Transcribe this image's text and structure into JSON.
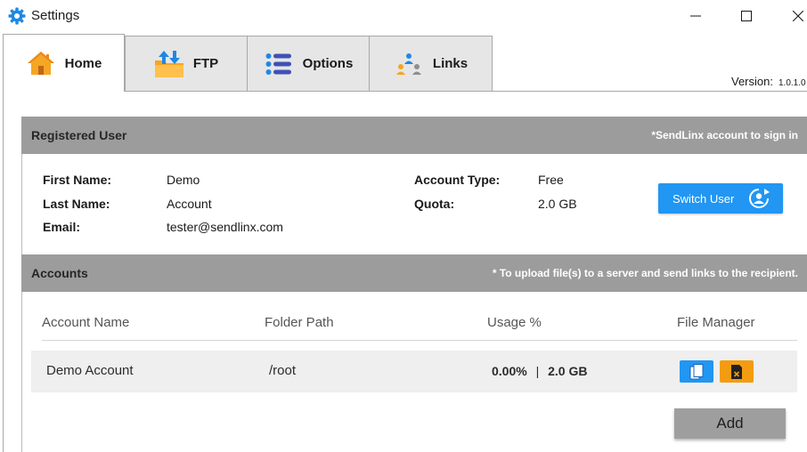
{
  "window": {
    "title": "Settings",
    "controls": [
      "minimize-icon",
      "maximize-icon",
      "close-icon"
    ]
  },
  "tabs": [
    {
      "label": "Home",
      "icon": "home-icon",
      "active": true
    },
    {
      "label": "FTP",
      "icon": "ftp-folder-icon",
      "active": false
    },
    {
      "label": "Options",
      "icon": "options-list-icon",
      "active": false
    },
    {
      "label": "Links",
      "icon": "links-people-icon",
      "active": false
    }
  ],
  "version": {
    "label": "Version:",
    "value": "1.0.1.0"
  },
  "registered_user": {
    "title": "Registered User",
    "note": "*SendLinx account to sign in",
    "first_name_label": "First Name:",
    "first_name": "Demo",
    "last_name_label": "Last Name:",
    "last_name": "Account",
    "email_label": "Email:",
    "email": "tester@sendlinx.com",
    "account_type_label": "Account Type:",
    "account_type": "Free",
    "quota_label": "Quota:",
    "quota": "2.0 GB",
    "switch_user_label": "Switch User"
  },
  "accounts": {
    "title": "Accounts",
    "note": "* To upload file(s) to a server and send links to the recipient.",
    "columns": [
      "Account Name",
      "Folder Path",
      "Usage %",
      "File Manager"
    ],
    "rows": [
      {
        "name": "Demo Account",
        "path": "/root",
        "usage": "0.00%",
        "separator": "|",
        "size": "2.0 GB"
      }
    ],
    "add_label": "Add"
  },
  "colors": {
    "accent_blue": "#2196f3",
    "accent_orange": "#f39c12",
    "header_gray": "#9c9c9c"
  }
}
